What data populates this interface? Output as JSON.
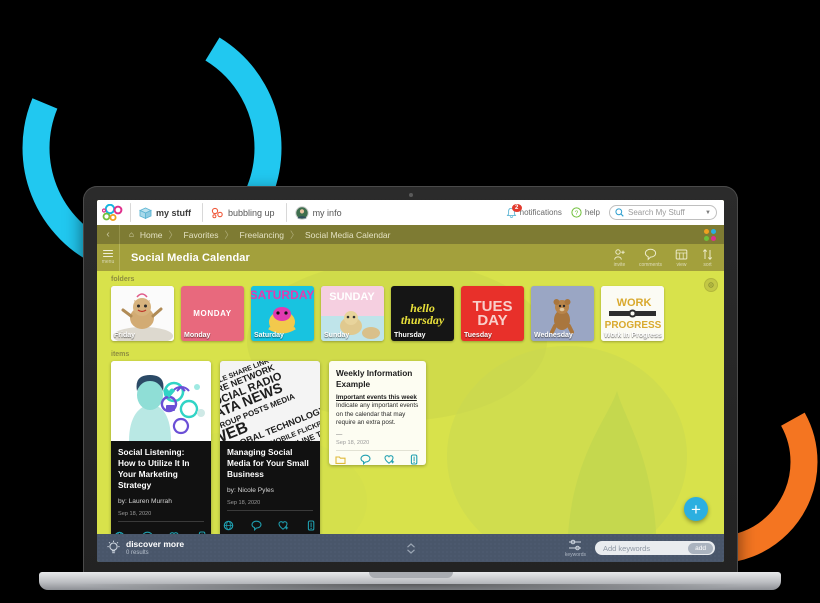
{
  "app": {
    "logo_name": "bubbling-logo",
    "tabs": [
      {
        "label": "my stuff",
        "icon": "box-icon",
        "active": true
      },
      {
        "label": "bubbling up",
        "icon": "bubbles-icon",
        "active": false
      },
      {
        "label": "my info",
        "icon": "avatar-icon",
        "active": false
      }
    ],
    "top_right": {
      "notifications_label": "notifications",
      "notifications_count": "2",
      "help_label": "help",
      "search_placeholder": "Search My Stuff"
    }
  },
  "breadcrumb": {
    "back_glyph": "‹",
    "items": [
      "Home",
      "Favorites",
      "Freelancing",
      "Social Media Calendar"
    ],
    "separator": "〉",
    "dot_colors": [
      "#f0a020",
      "#2cafe0",
      "#6fbf3a",
      "#e0308c"
    ]
  },
  "title_bar": {
    "menu_label": "menu",
    "page_title": "Social Media Calendar",
    "actions": [
      {
        "label": "invite",
        "icon": "person-plus-icon"
      },
      {
        "label": "comments",
        "icon": "comment-bubble-icon"
      },
      {
        "label": "view",
        "icon": "grid-view-icon"
      },
      {
        "label": "sort",
        "icon": "sort-arrows-icon"
      }
    ]
  },
  "sections": {
    "folders_label": "folders",
    "items_label": "items"
  },
  "folders": [
    {
      "name": "Friday",
      "art_text": "",
      "bg": "#ffffff",
      "art_color": "#c9a36b",
      "style": "cat"
    },
    {
      "name": "Monday",
      "art_text": "MONDAY",
      "bg": "#e8697d",
      "art_color": "#ffffff",
      "style": "flat"
    },
    {
      "name": "Saturday",
      "art_text": "SATURDAY",
      "bg": "#18c3e0",
      "art_color": "#e23bb0",
      "style": "flat"
    },
    {
      "name": "Sunday",
      "art_text": "SUNDAY",
      "bg": "#bfe4ea",
      "art_color": "#ffffff",
      "style": "flat"
    },
    {
      "name": "Thursday",
      "art_text": "hello thursday",
      "bg": "#151515",
      "art_color": "#e8e03a",
      "style": "script"
    },
    {
      "name": "Tuesday",
      "art_text": "TUES DAY",
      "bg": "#e8302a",
      "art_color": "#f6c6c2",
      "style": "flat"
    },
    {
      "name": "Wednesday",
      "art_text": "",
      "bg": "#9aa6c4",
      "art_color": "#a9763e",
      "style": "bear"
    },
    {
      "name": "Work In Progress",
      "art_text": "WORK IN PROGRESS",
      "bg": "#fbfbf4",
      "art_color": "#d9bf3e",
      "style": "wip"
    }
  ],
  "items": [
    {
      "type": "article",
      "title": "Social Listening: How to Utilize It In Your Marketing Strategy",
      "author": "by: Lauren Murrah",
      "date": "Sep 18, 2020",
      "thumb": "social-listening-illustration",
      "icons": [
        "link-icon",
        "comment-icon",
        "heart-plus-icon",
        "attach-icon"
      ]
    },
    {
      "type": "article",
      "title": "Managing Social Media for Your Small Business",
      "author": "by: Nicole Pyles",
      "date": "Sep 18, 2020",
      "thumb": "word-collage",
      "icons": [
        "link-icon",
        "comment-icon",
        "heart-plus-icon",
        "attach-icon"
      ]
    },
    {
      "type": "note",
      "title": "Weekly Information Example",
      "subtitle": "Important events this week",
      "text": "Indicate any important events on the calendar that may require an extra post.",
      "dash": "—",
      "date": "Sep 18, 2020",
      "icons": [
        "note-icon",
        "comment-icon",
        "heart-plus-icon",
        "attach-icon"
      ]
    }
  ],
  "fab": {
    "label": "+",
    "color": "#2cafe0",
    "name": "add-button"
  },
  "bottom_bar": {
    "discover_title": "discover more",
    "discover_sub": "0 results",
    "keywords_label": "keywords",
    "keywords_placeholder": "Add keywords",
    "add_button": "add"
  },
  "theme": {
    "canvas_bg": "#d8e24b",
    "title_bar_bg": "#a3a03c",
    "crumb_bar_bg": "#7e7b33",
    "bottom_bar_bg": "#49566a",
    "accent_cyan": "#21c8f0",
    "accent_orange": "#f47521"
  }
}
